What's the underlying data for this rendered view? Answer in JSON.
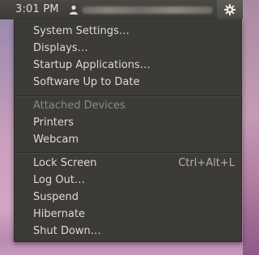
{
  "panel": {
    "clock": "3:01 PM",
    "user_icon": "user-icon",
    "gear_icon": "gear-icon"
  },
  "menu": {
    "group1": [
      "System Settings…",
      "Displays…",
      "Startup Applications…",
      "Software Up to Date"
    ],
    "devices_header": "Attached Devices",
    "group2": [
      "Printers",
      "Webcam"
    ],
    "group3": [
      {
        "label": "Lock Screen",
        "shortcut": "Ctrl+Alt+L"
      },
      {
        "label": "Log Out…",
        "shortcut": ""
      },
      {
        "label": "Suspend",
        "shortcut": ""
      },
      {
        "label": "Hibernate",
        "shortcut": ""
      },
      {
        "label": "Shut Down…",
        "shortcut": ""
      }
    ]
  },
  "colors": {
    "panel_bg": "#3c3b37",
    "menu_bg": "#3c3b37",
    "menu_text": "#dfdbd2",
    "header_text": "#8d8a83"
  }
}
